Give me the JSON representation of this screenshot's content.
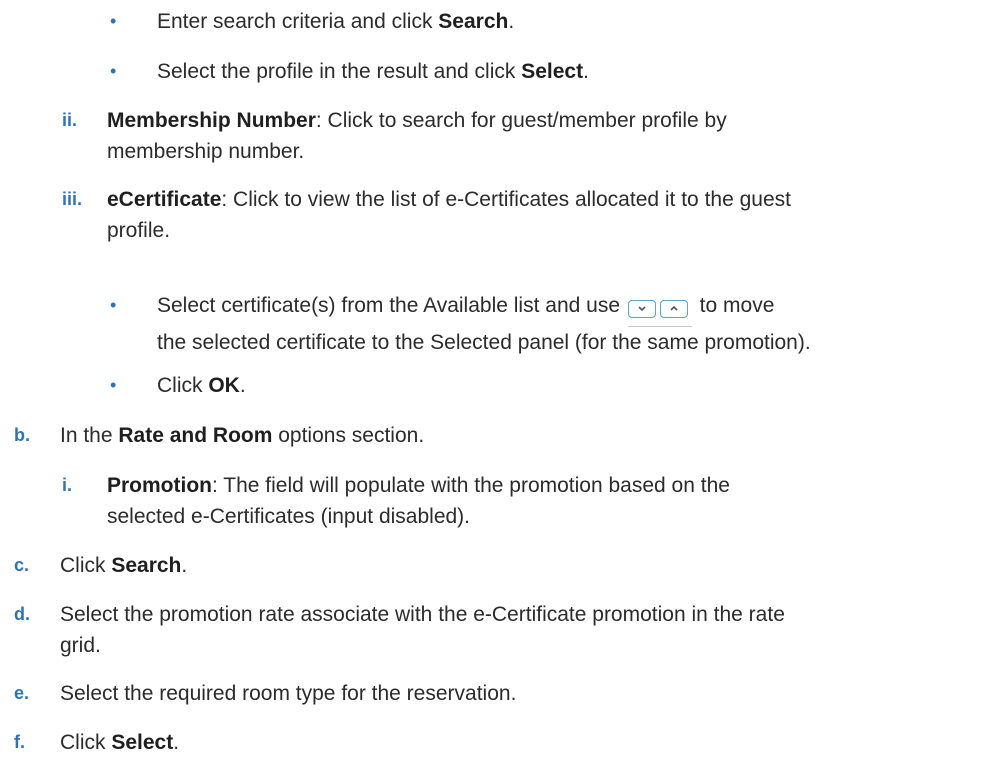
{
  "lines": {
    "bullet1": {
      "pre": "Enter search criteria and click ",
      "bold": "Search",
      "post": "."
    },
    "bullet2": {
      "pre": "Select the profile in the result and click ",
      "bold": "Select",
      "post": "."
    },
    "ii": {
      "marker": "ii.",
      "bold": "Membership Number",
      "rest1": ": Click to search for guest/member profile by",
      "rest2": "membership number."
    },
    "iii": {
      "marker": "iii.",
      "bold": "eCertificate",
      "rest1": ": Click to view the list of e-Certificates allocated it to the guest",
      "rest2": "profile."
    },
    "bullet3": {
      "pre": "Select certificate(s) from the Available list and use ",
      "post": " to move",
      "line2": "the selected certificate to the Selected panel (for the same promotion)."
    },
    "bullet4": {
      "pre": "Click ",
      "bold": "OK",
      "post": "."
    },
    "b": {
      "marker": "b.",
      "pre": "In the ",
      "bold": "Rate and Room",
      "post": " options section."
    },
    "i": {
      "marker": "i.",
      "bold": "Promotion",
      "rest1": ": The field will populate with the promotion based on the",
      "rest2": "selected e-Certificates (input disabled)."
    },
    "c": {
      "marker": "c.",
      "pre": "Click ",
      "bold": "Search",
      "post": "."
    },
    "d": {
      "marker": "d.",
      "line1": "Select the promotion rate associate with the e-Certificate promotion in the rate",
      "line2": "grid."
    },
    "e": {
      "marker": "e.",
      "line1": "Select the required room type for the reservation."
    },
    "f": {
      "marker": "f.",
      "pre": "Click ",
      "bold": "Select",
      "post": "."
    }
  },
  "icons": {
    "down": "chevron-down-icon",
    "up": "chevron-up-icon"
  }
}
